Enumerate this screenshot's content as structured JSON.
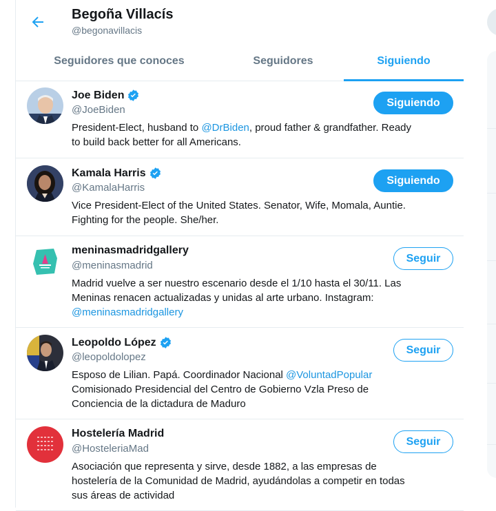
{
  "header": {
    "name": "Begoña Villacís",
    "handle": "@begonavillacis"
  },
  "tabs": [
    {
      "label": "Seguidores que conoces"
    },
    {
      "label": "Seguidores"
    },
    {
      "label": "Siguiendo",
      "active": true
    }
  ],
  "colors": {
    "accent": "#1da1f2",
    "mention": "#1b95e0",
    "text": "#14171a",
    "secondary": "#657786"
  },
  "users": [
    {
      "name": "Joe Biden",
      "verified": true,
      "handle": "@JoeBiden",
      "button": "Siguiendo",
      "bio_l1_a": "President-Elect, husband to ",
      "bio_l1_mention": "@DrBiden",
      "bio_l1_b": ", proud father & grandfather. Ready",
      "bio_l2": "to build back better for all Americans."
    },
    {
      "name": "Kamala Harris",
      "verified": true,
      "handle": "@KamalaHarris",
      "button": "Siguiendo",
      "bio_l1": "Vice President-Elect of the United States. Senator, Wife, Momala, Auntie.",
      "bio_l2": "Fighting for the people. She/her."
    },
    {
      "name": "meninasmadridgallery",
      "verified": false,
      "handle": "@meninasmadrid",
      "button": "Seguir",
      "bio_l1": "Madrid vuelve a ser nuestro escenario desde el 1/10 hasta el 30/11. Las",
      "bio_l2": "Meninas renacen actualizadas y unidas al arte urbano. Instagram:",
      "bio_l3_mention": "@meninasmadridgallery"
    },
    {
      "name": "Leopoldo López",
      "verified": true,
      "handle": "@leopoldolopez",
      "button": "Seguir",
      "bio_l1_a": "Esposo de Lilian. Papá. Coordinador Nacional ",
      "bio_l1_mention": "@VoluntadPopular",
      "bio_l2": "Comisionado Presidencial del Centro de Gobierno Vzla Preso de",
      "bio_l3": "Conciencia de la dictadura de Maduro"
    },
    {
      "name": "Hostelería Madrid",
      "verified": false,
      "handle": "@HosteleriaMad",
      "button": "Seguir",
      "bio_l1": "Asociación que representa y sirve, desde 1882, a las empresas de",
      "bio_l2": "hostelería de la Comunidad de Madrid, ayudándolas a competir en todas",
      "bio_l3": "sus áreas de actividad"
    }
  ]
}
